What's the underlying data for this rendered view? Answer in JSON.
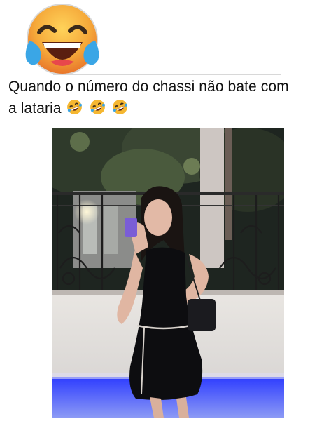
{
  "post": {
    "caption_line1": "Quando o número do chassi não bate com",
    "caption_line2": "a lataria",
    "caption_emojis": [
      "rolling-on-floor-laughing-icon",
      "rolling-on-floor-laughing-icon",
      "rolling-on-floor-laughing-icon"
    ],
    "header_emoji": "face-with-tears-of-joy-icon"
  },
  "colors": {
    "emoji_yellow": "#f5b731",
    "emoji_orange": "#ee8a2a",
    "tear_blue": "#3aa6e6",
    "underlight_blue": "#2f3fff"
  }
}
